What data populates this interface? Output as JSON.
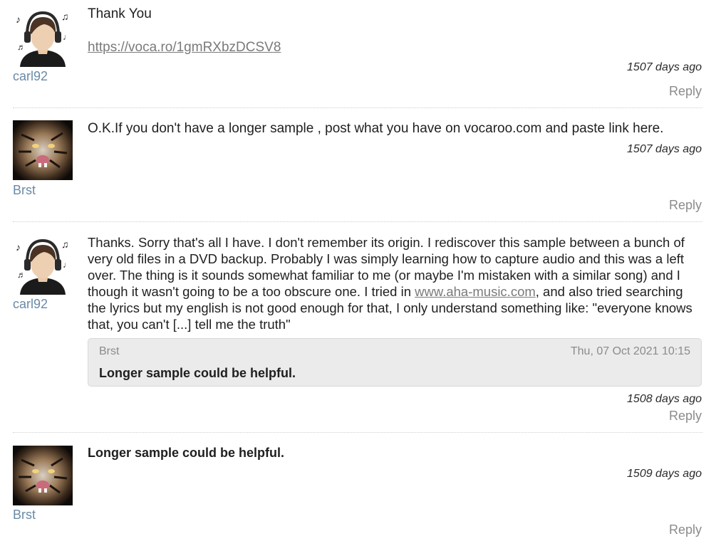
{
  "comments": [
    {
      "user": "carl92",
      "avatar_icon": "headphones-avatar-icon",
      "text": "Thank You",
      "link": "https://voca.ro/1gmRXbzDCSV8",
      "age": "1507 days ago",
      "reply": "Reply"
    },
    {
      "user": "Brst",
      "avatar_icon": "tiger-avatar-icon",
      "text": "O.K.If you don't have a longer sample , post what you have on vocaroo.com and paste link here.",
      "age": "1507 days ago",
      "reply": "Reply"
    },
    {
      "user": "carl92",
      "avatar_icon": "headphones-avatar-icon",
      "text_before_link": "Thanks. Sorry that's all I have. I don't remember its origin. I rediscover this sample between a bunch of very old files in a DVD backup. Probably I was simply learning how to capture audio and this was a left over. The thing is it sounds somewhat familiar to me (or maybe I'm mistaken with a similar song) and I though it wasn't going to be a too obscure one. I tried in ",
      "link": "www.aha-music.com",
      "text_after_link": ", and also tried searching the lyrics but my english is not good enough for that, I only understand something like: \"everyone knows that, you can't [...] tell me the truth\"",
      "quote": {
        "author": "Brst",
        "date": "Thu, 07 Oct 2021 10:15",
        "text": "Longer sample could be helpful."
      },
      "age": "1508 days ago",
      "reply": "Reply"
    },
    {
      "user": "Brst",
      "avatar_icon": "tiger-avatar-icon",
      "text": "Longer sample could be helpful.",
      "age": "1509 days ago",
      "reply": "Reply"
    }
  ],
  "colors": {
    "username": "#6a8aa6",
    "reply": "#8b8b8b",
    "link": "#7a7a7a",
    "quote_bg": "#ebebeb"
  }
}
